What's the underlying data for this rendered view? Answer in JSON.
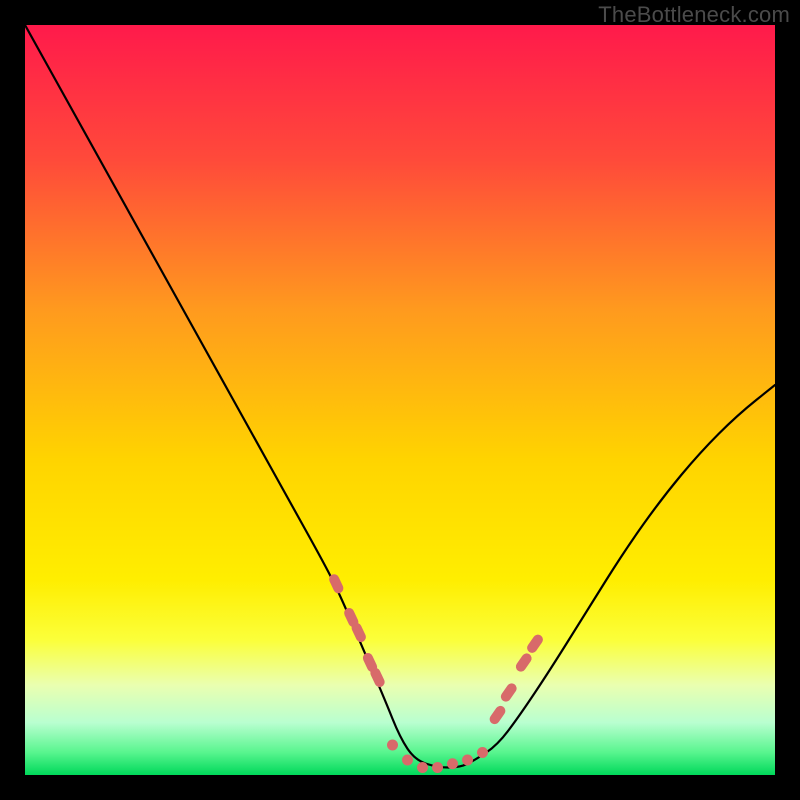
{
  "watermark": "TheBottleneck.com",
  "chart_data": {
    "type": "line",
    "title": "",
    "xlabel": "",
    "ylabel": "",
    "xlim": [
      0,
      100
    ],
    "ylim": [
      0,
      100
    ],
    "grid": false,
    "legend": false,
    "background_gradient": {
      "top_color": "#ff1a4b",
      "mid_colors": [
        "#ff6a2a",
        "#ffb814",
        "#ffe500",
        "#ffff4a"
      ],
      "bottom_color": "#00e05a"
    },
    "series": [
      {
        "name": "curve",
        "stroke": "#000000",
        "x": [
          0,
          5,
          10,
          15,
          20,
          25,
          30,
          35,
          40,
          42,
          45,
          48,
          50,
          52,
          55,
          58,
          60,
          63,
          66,
          70,
          75,
          80,
          85,
          90,
          95,
          100
        ],
        "y": [
          100,
          91,
          82,
          73,
          64,
          55,
          46,
          37,
          28,
          24,
          17,
          10,
          5,
          2,
          1,
          1,
          2,
          4,
          8,
          14,
          22,
          30,
          37,
          43,
          48,
          52
        ]
      },
      {
        "name": "markers-left",
        "stroke": "#d86a6a",
        "shape": "capsule",
        "x": [
          41.5,
          43.5,
          44.5,
          46.0,
          47.0
        ],
        "y": [
          25.5,
          21.0,
          19.0,
          15.0,
          13.0
        ]
      },
      {
        "name": "markers-bottom",
        "stroke": "#d86a6a",
        "shape": "dot",
        "x": [
          49.0,
          51.0,
          53.0,
          55.0,
          57.0,
          59.0,
          61.0
        ],
        "y": [
          4.0,
          2.0,
          1.0,
          1.0,
          1.5,
          2.0,
          3.0
        ]
      },
      {
        "name": "markers-right",
        "stroke": "#d86a6a",
        "shape": "capsule",
        "x": [
          63.0,
          64.5,
          66.5,
          68.0
        ],
        "y": [
          8.0,
          11.0,
          15.0,
          17.5
        ]
      }
    ]
  }
}
